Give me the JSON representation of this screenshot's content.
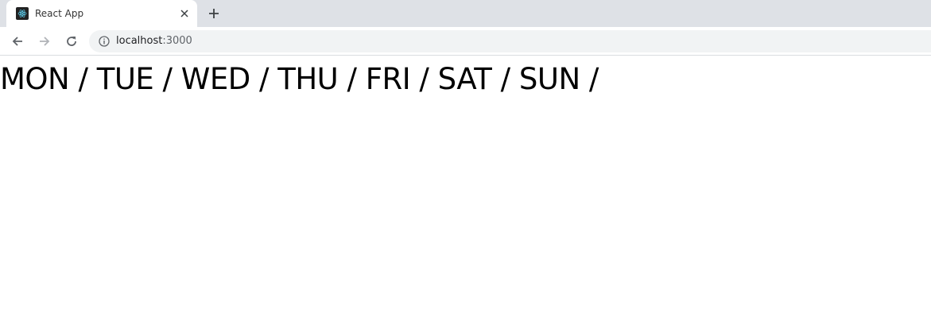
{
  "browser": {
    "tab": {
      "title": "React App",
      "favicon_icon": "react-logo-icon"
    },
    "toolbar": {
      "url_host": "localhost",
      "url_port": ":3000"
    }
  },
  "page": {
    "days": [
      {
        "label": "MON",
        "sep": " / "
      },
      {
        "label": "TUE",
        "sep": " / "
      },
      {
        "label": "WED",
        "sep": " / "
      },
      {
        "label": "THU",
        "sep": " / "
      },
      {
        "label": "FRI",
        "sep": " / "
      },
      {
        "label": "SAT",
        "sep": " / "
      },
      {
        "label": "SUN",
        "sep": " /"
      }
    ]
  }
}
